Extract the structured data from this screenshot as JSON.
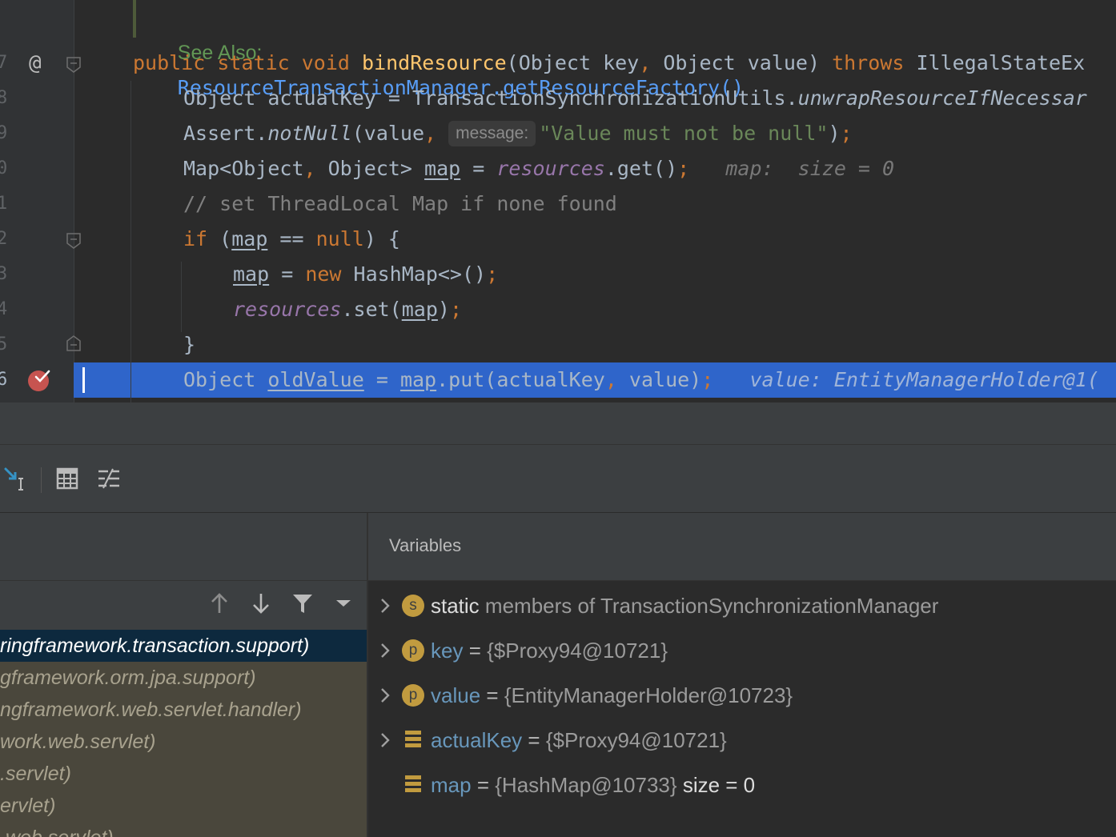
{
  "editor": {
    "doc_see_also_label": "See Also:",
    "doc_see_also_link": "ResourceTransactionManager.getResourceFactory()",
    "line_numbers": [
      "7",
      "8",
      "9",
      "0",
      "1",
      "2",
      "3",
      "4",
      "5",
      "6"
    ],
    "gutter": {
      "override_marker": "@"
    },
    "lines": {
      "l7": {
        "public": "public",
        "static": "static",
        "void": "void",
        "method": "bindResource",
        "params": "(Object key",
        "comma": ",",
        "params2": " Object value) ",
        "throws": "throws",
        "exc": " IllegalStateEx"
      },
      "l8": {
        "pre": "Object actualKey = TransactionSynchronizationUtils.",
        "call": "unwrapResourceIfNecessar"
      },
      "l9": {
        "pre": "Assert.",
        "call": "notNull",
        "args": "(value",
        "comma": ",",
        "param_hint": "message:",
        "str": "\"Value must not be null\"",
        "close": ")",
        "semi": ";"
      },
      "l10": {
        "type": "Map<Object",
        "comma": ",",
        "type2": " Object> ",
        "var": "map",
        "eq": " = ",
        "field": "resources",
        "call": ".get()",
        "semi": ";",
        "hint": "map:  size = 0"
      },
      "l11": {
        "comment": "// set ThreadLocal Map if none found"
      },
      "l12": {
        "if": "if",
        "open": " (",
        "var": "map",
        "mid": " == ",
        "null": "null",
        "close": ") {"
      },
      "l13": {
        "var": "map",
        "eq": " = ",
        "new": "new",
        "rest": " HashMap<>()",
        "semi": ";"
      },
      "l14": {
        "field": "resources",
        "call": ".set(",
        "var": "map",
        "close": ")",
        "semi": ";"
      },
      "l15": {
        "brace": "}"
      },
      "l16": {
        "type": "Object ",
        "var": "oldValue",
        "eq": " = ",
        "map": "map",
        "call": ".put(actualKey",
        "comma": ",",
        "rest": " value)",
        "semi": ";",
        "hint": "value: EntityManagerHolder@1("
      }
    }
  },
  "variables": {
    "title": "Variables",
    "rows": [
      {
        "badge": "s",
        "name": "static",
        "value": "members of TransactionSynchronizationManager",
        "expandable": true
      },
      {
        "badge": "p",
        "name": "key",
        "eq": "=",
        "value": "{$Proxy94@10721}",
        "expandable": true
      },
      {
        "badge": "p",
        "name": "value",
        "eq": "=",
        "value": "{EntityManagerHolder@10723}",
        "expandable": true
      },
      {
        "badge": "field",
        "name": "actualKey",
        "eq": "=",
        "value": "{$Proxy94@10721}",
        "expandable": true
      },
      {
        "badge": "field",
        "name": "map",
        "eq": "=",
        "value": "{HashMap@10733}",
        "extra": "size = 0",
        "expandable": false
      }
    ]
  },
  "frames": {
    "rows": [
      "ringframework.transaction.support)",
      "gframework.orm.jpa.support)",
      "ngframework.web.servlet.handler)",
      "work.web.servlet)",
      ".servlet)",
      "ervlet)",
      ".web.servlet)"
    ]
  },
  "colors": {
    "editor_bg": "#2b2b2b",
    "highlight": "#2f65ca",
    "keyword": "#cc7832",
    "string": "#6a8759",
    "field": "#9876aa",
    "link": "#589df6",
    "selected_frame": "#0d293e"
  }
}
